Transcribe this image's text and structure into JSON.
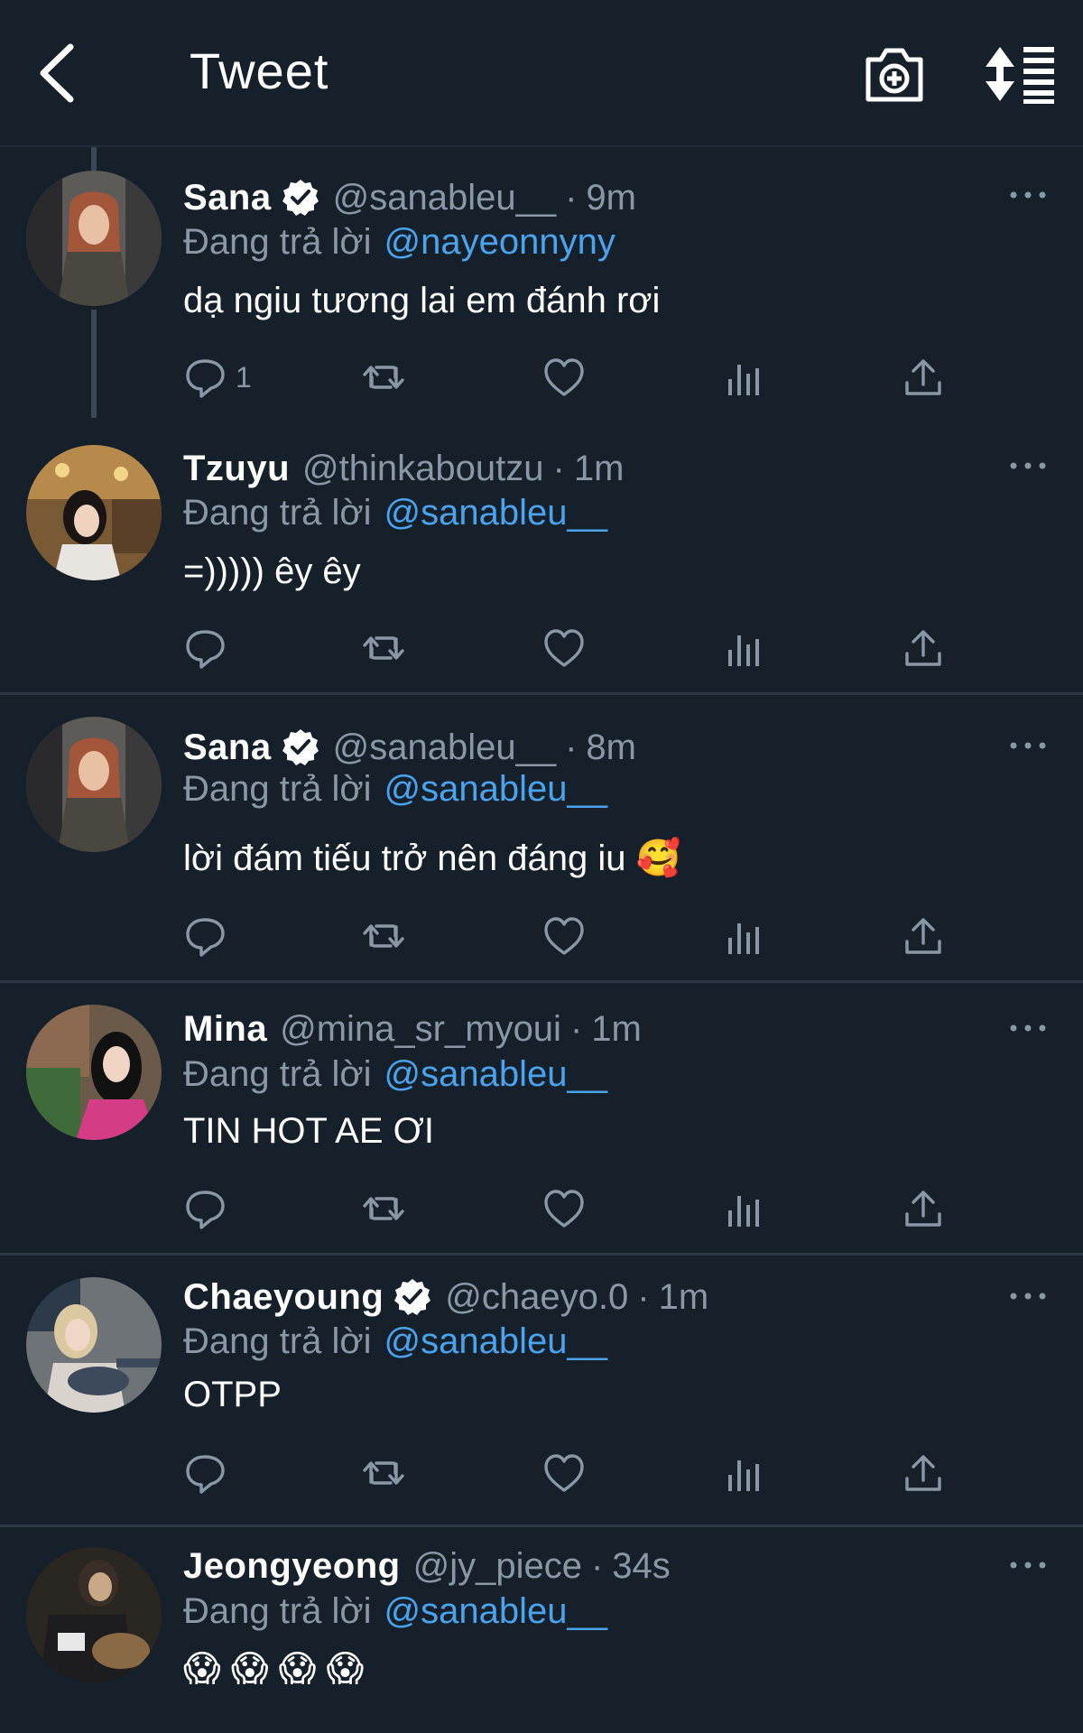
{
  "header": {
    "title": "Tweet"
  },
  "reply_label": "Đang trả lời",
  "tweets": [
    {
      "name": "Sana",
      "verified": true,
      "handle": "@sanableu__",
      "dot": "·",
      "time": "9m",
      "replying_to": "@nayeonnyny",
      "text": "dạ ngiu tương lai em đánh rơi",
      "reply_count": "1"
    },
    {
      "name": "Tzuyu",
      "verified": false,
      "handle": "@thinkaboutzu",
      "dot": "·",
      "time": "1m",
      "replying_to": "@sanableu__",
      "text": "=))))) êy êy",
      "reply_count": ""
    },
    {
      "name": "Sana",
      "verified": true,
      "handle": "@sanableu__",
      "dot": "·",
      "time": "8m",
      "replying_to": "@sanableu__",
      "text": "lời đám tiếu trở nên đáng iu 🥰",
      "reply_count": ""
    },
    {
      "name": "Mina",
      "verified": false,
      "handle": "@mina_sr_myoui",
      "dot": "·",
      "time": "1m",
      "replying_to": "@sanableu__",
      "text": "TIN HOT AE ƠI",
      "reply_count": ""
    },
    {
      "name": "Chaeyoung",
      "verified": true,
      "handle": "@chaeyo.0",
      "dot": "·",
      "time": "1m",
      "replying_to": "@sanableu__",
      "text": "OTPP",
      "reply_count": ""
    },
    {
      "name": "Jeongyeong",
      "verified": false,
      "handle": "@jy_piece",
      "dot": "·",
      "time": "34s",
      "replying_to": "@sanableu__",
      "text": "😱 😱 😱 😱",
      "reply_count": ""
    }
  ],
  "colors": {
    "background": "#16202b",
    "muted": "#8a98a6",
    "link": "#4aa3ec",
    "divider": "#2b3846"
  },
  "icons": [
    "back-arrow-icon",
    "camera-plus-icon",
    "sort-icon",
    "reply-icon",
    "retweet-icon",
    "like-icon",
    "views-icon",
    "share-icon",
    "more-icon",
    "verified-icon"
  ]
}
